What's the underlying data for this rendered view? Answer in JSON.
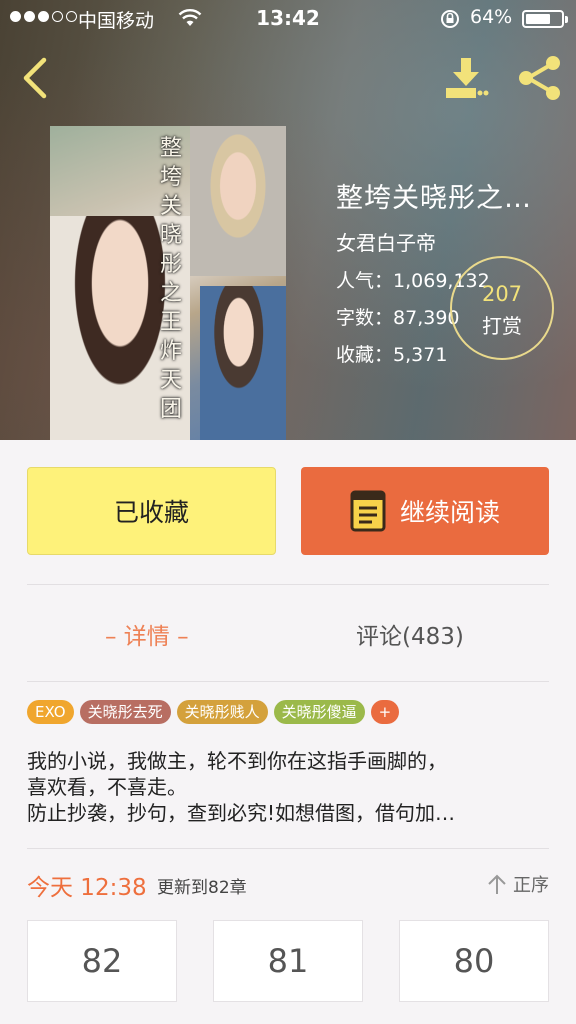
{
  "status_bar": {
    "carrier": "中国移动",
    "time": "13:42",
    "battery": "64%"
  },
  "book": {
    "title": "整垮关晓彤之…",
    "cover_text": "整垮关晓彤之王炸天团",
    "author": "女君白子帝",
    "popularity_label": "人气：",
    "popularity": "1,069,132",
    "words_label": "字数：",
    "words": "87,390",
    "favorites_label": "收藏：",
    "favorites": "5,371",
    "reward_count": "207",
    "reward_label": "打赏"
  },
  "actions": {
    "favorited_label": "已收藏",
    "continue_label": "继续阅读"
  },
  "tabs": {
    "detail": "– 详情 –",
    "comments": "评论(483)"
  },
  "tags": [
    {
      "label": "EXO",
      "color": "#f0a62e"
    },
    {
      "label": "关晓彤去死",
      "color": "#b86e62"
    },
    {
      "label": "关晓彤贱人",
      "color": "#d4a13c"
    },
    {
      "label": "关晓彤傻逼",
      "color": "#9bb94a"
    },
    {
      "label": "+",
      "color": "#ea6b3f"
    }
  ],
  "description": [
    "我的小说，我做主，轮不到你在这指手画脚的，",
    "喜欢看，不喜走。",
    "防止抄袭，抄句，查到必究!如想借图，借句加…"
  ],
  "update": {
    "time": "今天 12:38",
    "text": "更新到82章",
    "order_label": "正序"
  },
  "chapters": [
    "82",
    "81",
    "80"
  ],
  "colors": {
    "accent_orange": "#ea6b3f",
    "favorite_yellow": "#fef27a",
    "reward_gold": "#f2e27a"
  },
  "icons": [
    "back-icon",
    "download-icon",
    "share-icon",
    "book-icon",
    "arrow-up-icon",
    "wifi-icon",
    "rotation-lock-icon",
    "battery-icon"
  ]
}
